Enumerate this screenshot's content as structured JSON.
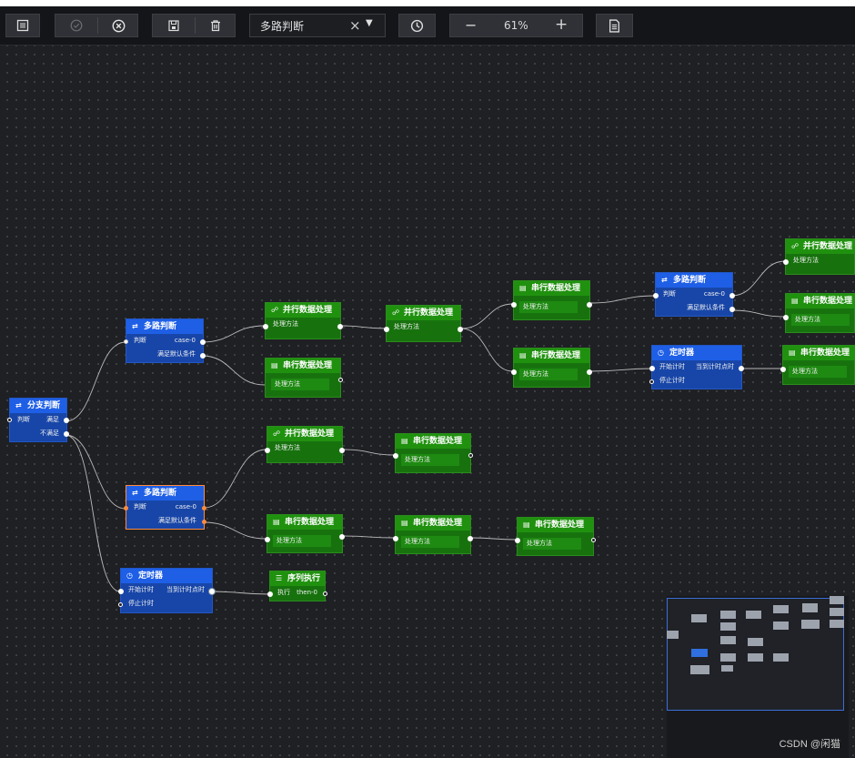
{
  "toolbar": {
    "layout_icon": "layout-icon",
    "check_icon": "check-circle-icon",
    "cancel_icon": "close-circle-icon",
    "save_icon": "save-icon",
    "delete_icon": "trash-icon",
    "node_select": {
      "value": "多路判断",
      "clear": "×",
      "caret": "▼"
    },
    "refresh_icon": "refresh-icon",
    "zoom_out": "−",
    "zoom": "61%",
    "zoom_in": "+",
    "doc_icon": "document-icon"
  },
  "nodes": {
    "branch": {
      "title": "分支判断",
      "in": "判断",
      "out1": "满足",
      "out2": "不满足"
    },
    "multi1": {
      "title": "多路判断",
      "in": "判断",
      "case": "case-0",
      "default": "满足默认条件"
    },
    "multi2": {
      "title": "多路判断",
      "in": "判断",
      "case": "case-0",
      "default": "满足默认条件"
    },
    "multi3": {
      "title": "多路判断",
      "in": "判断",
      "case": "case-0",
      "default": "满足默认条件"
    },
    "timer1": {
      "title": "定时器",
      "start": "开始计时",
      "reach": "当到计时点时",
      "stop": "停止计时"
    },
    "timer2": {
      "title": "定时器",
      "start": "开始计时",
      "reach": "当到计时点时",
      "stop": "停止计时"
    },
    "seq": {
      "title": "序列执行",
      "in": "执行",
      "out": "then-0"
    },
    "parallel_title": "并行数据处理",
    "serial_title": "串行数据处理",
    "method": "处理方法"
  },
  "watermark": "CSDN @闲猫",
  "colors": {
    "accent_blue": "#1e5fe6",
    "node_green": "#20910f",
    "selected": "#ff8a3d"
  }
}
